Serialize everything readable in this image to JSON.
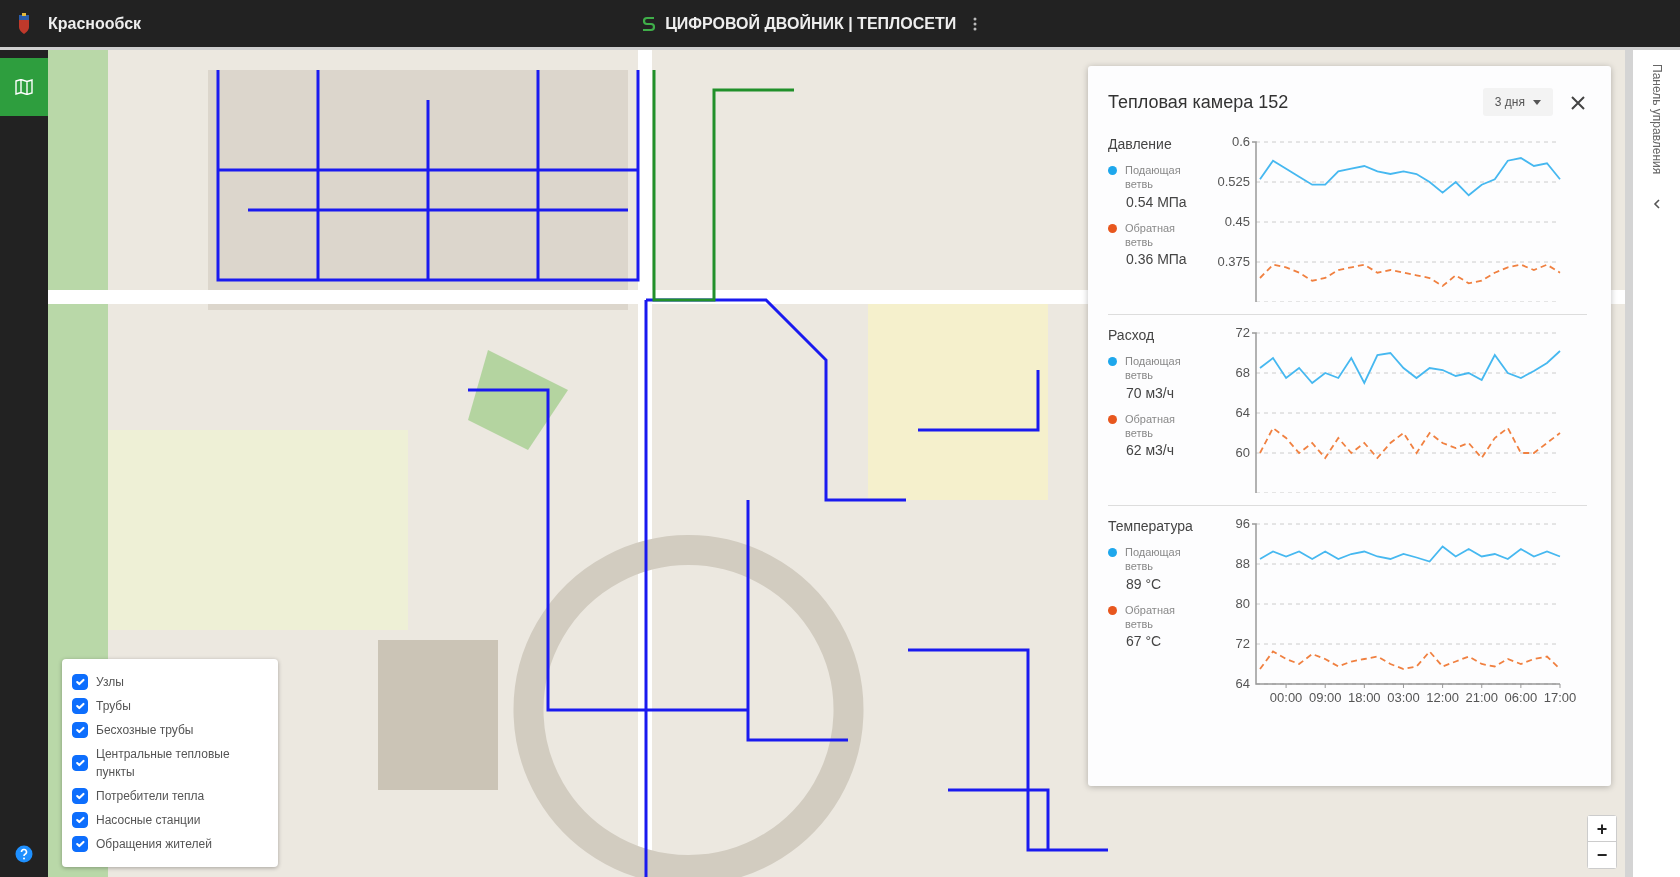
{
  "header": {
    "city": "Краснообск",
    "app_title": "ЦИФРОВОЙ ДВОЙНИК | ТЕПЛОСЕТИ"
  },
  "sidebar": {
    "items": [
      {
        "kind": "map",
        "selected": true
      },
      {
        "kind": "help",
        "selected": false
      }
    ]
  },
  "layers": [
    {
      "label": "Узлы",
      "checked": true
    },
    {
      "label": "Трубы",
      "checked": true
    },
    {
      "label": "Бесхозные трубы",
      "checked": true
    },
    {
      "label": "Центральные тепловые пункты",
      "checked": true
    },
    {
      "label": "Потребители тепла",
      "checked": true
    },
    {
      "label": "Насосные станции",
      "checked": true
    },
    {
      "label": "Обращения жителей",
      "checked": true
    }
  ],
  "map": {
    "kind": "picture"
  },
  "zoom_controls": [
    "+",
    "−"
  ],
  "panel": {
    "title": "Тепловая камера 152",
    "period": "3 дня",
    "sections": [
      {
        "title": "Давление",
        "legend": [
          {
            "label": "Подающая ветвь",
            "reading": "0.54 МПа",
            "color": "#1ea7ec"
          },
          {
            "label": "Обратная ветвь",
            "reading": "0.36 МПа",
            "color": "#e8571e"
          }
        ],
        "chart_data": {
          "type": "line",
          "grid": true,
          "categories": [
            null,
            null,
            null,
            null,
            null,
            null,
            null,
            null,
            null,
            null,
            null,
            null,
            null,
            null,
            null,
            null,
            null,
            null,
            null,
            null,
            null,
            null,
            null,
            null
          ],
          "ylim": [
            0.3,
            0.6
          ],
          "yticks": [
            {
              "value": 0.375,
              "label": "0.375"
            },
            {
              "value": 0.45,
              "label": "0.45"
            },
            {
              "value": 0.525,
              "label": "0.525"
            },
            {
              "value": 0.6,
              "label": "0.6"
            }
          ],
          "series": [
            {
              "color": "#46b8f0",
              "line_style": "solid",
              "values": [
                0.53,
                0.565,
                0.55,
                0.535,
                0.52,
                0.52,
                0.545,
                0.55,
                0.555,
                0.545,
                0.54,
                0.545,
                0.54,
                0.525,
                0.505,
                0.525,
                0.5,
                0.52,
                0.53,
                0.565,
                0.57,
                0.555,
                0.56,
                0.53
              ]
            },
            {
              "color": "#f08040",
              "line_style": "dashed",
              "values": [
                0.345,
                0.37,
                0.365,
                0.355,
                0.34,
                0.345,
                0.36,
                0.365,
                0.37,
                0.355,
                0.36,
                0.355,
                0.35,
                0.345,
                0.33,
                0.35,
                0.335,
                0.34,
                0.355,
                0.365,
                0.37,
                0.36,
                0.37,
                0.355
              ]
            }
          ]
        }
      },
      {
        "title": "Расход",
        "legend": [
          {
            "label": "Подающая ветвь",
            "reading": "70 м3/ч",
            "color": "#1ea7ec"
          },
          {
            "label": "Обратная ветвь",
            "reading": "62 м3/ч",
            "color": "#e8571e"
          }
        ],
        "chart_data": {
          "type": "line",
          "grid": true,
          "categories": [
            null,
            null,
            null,
            null,
            null,
            null,
            null,
            null,
            null,
            null,
            null,
            null,
            null,
            null,
            null,
            null,
            null,
            null,
            null,
            null,
            null,
            null,
            null,
            null
          ],
          "ylim": [
            56,
            72
          ],
          "yticks": [
            60,
            64,
            68,
            72
          ],
          "series": [
            {
              "color": "#46b8f0",
              "line_style": "solid",
              "values": [
                68.5,
                69.5,
                67.5,
                68.5,
                67,
                68,
                67.5,
                69.5,
                67,
                69.8,
                70,
                68.5,
                67.5,
                68.5,
                68.3,
                67.7,
                68,
                67.3,
                69.8,
                68,
                67.5,
                68.2,
                69,
                70.2
              ]
            },
            {
              "color": "#f08040",
              "line_style": "dashed",
              "values": [
                60,
                62.5,
                61.5,
                60,
                61,
                59.5,
                61.5,
                60,
                61,
                59.5,
                61,
                62,
                60,
                62,
                61,
                60.5,
                61,
                59.5,
                61.5,
                62.5,
                60,
                60,
                61,
                62
              ]
            }
          ]
        }
      },
      {
        "title": "Температура",
        "legend": [
          {
            "label": "Подающая ветвь",
            "reading": "89 °C",
            "color": "#1ea7ec"
          },
          {
            "label": "Обратная ветвь",
            "reading": "67 °C",
            "color": "#e8571e"
          }
        ],
        "chart_data": {
          "type": "line",
          "grid": true,
          "categories": [
            null,
            null,
            "00:00",
            null,
            null,
            "09:00",
            null,
            null,
            "18:00",
            null,
            null,
            "03:00",
            null,
            null,
            "12:00",
            null,
            null,
            "21:00",
            null,
            null,
            "06:00",
            null,
            null,
            "17:00"
          ],
          "ylim": [
            64,
            96
          ],
          "yticks": [
            64,
            72,
            80,
            88,
            96
          ],
          "series": [
            {
              "color": "#46b8f0",
              "line_style": "solid",
              "values": [
                89,
                90.5,
                89.5,
                90.5,
                89,
                90.5,
                89,
                90,
                90.5,
                89.5,
                89,
                90,
                89.3,
                88.5,
                91.5,
                89.5,
                91,
                89.5,
                90,
                89,
                91,
                89.5,
                90.5,
                89.5
              ]
            },
            {
              "color": "#f08040",
              "line_style": "dashed",
              "values": [
                67,
                70.5,
                69,
                68,
                70,
                69,
                67.5,
                68.5,
                69,
                69.5,
                68,
                67,
                67.5,
                70.5,
                67.5,
                68.5,
                69.5,
                68,
                67.5,
                69,
                68,
                69,
                69.5,
                67
              ]
            }
          ]
        }
      }
    ]
  },
  "control_panel": {
    "label": "Панель управления"
  }
}
